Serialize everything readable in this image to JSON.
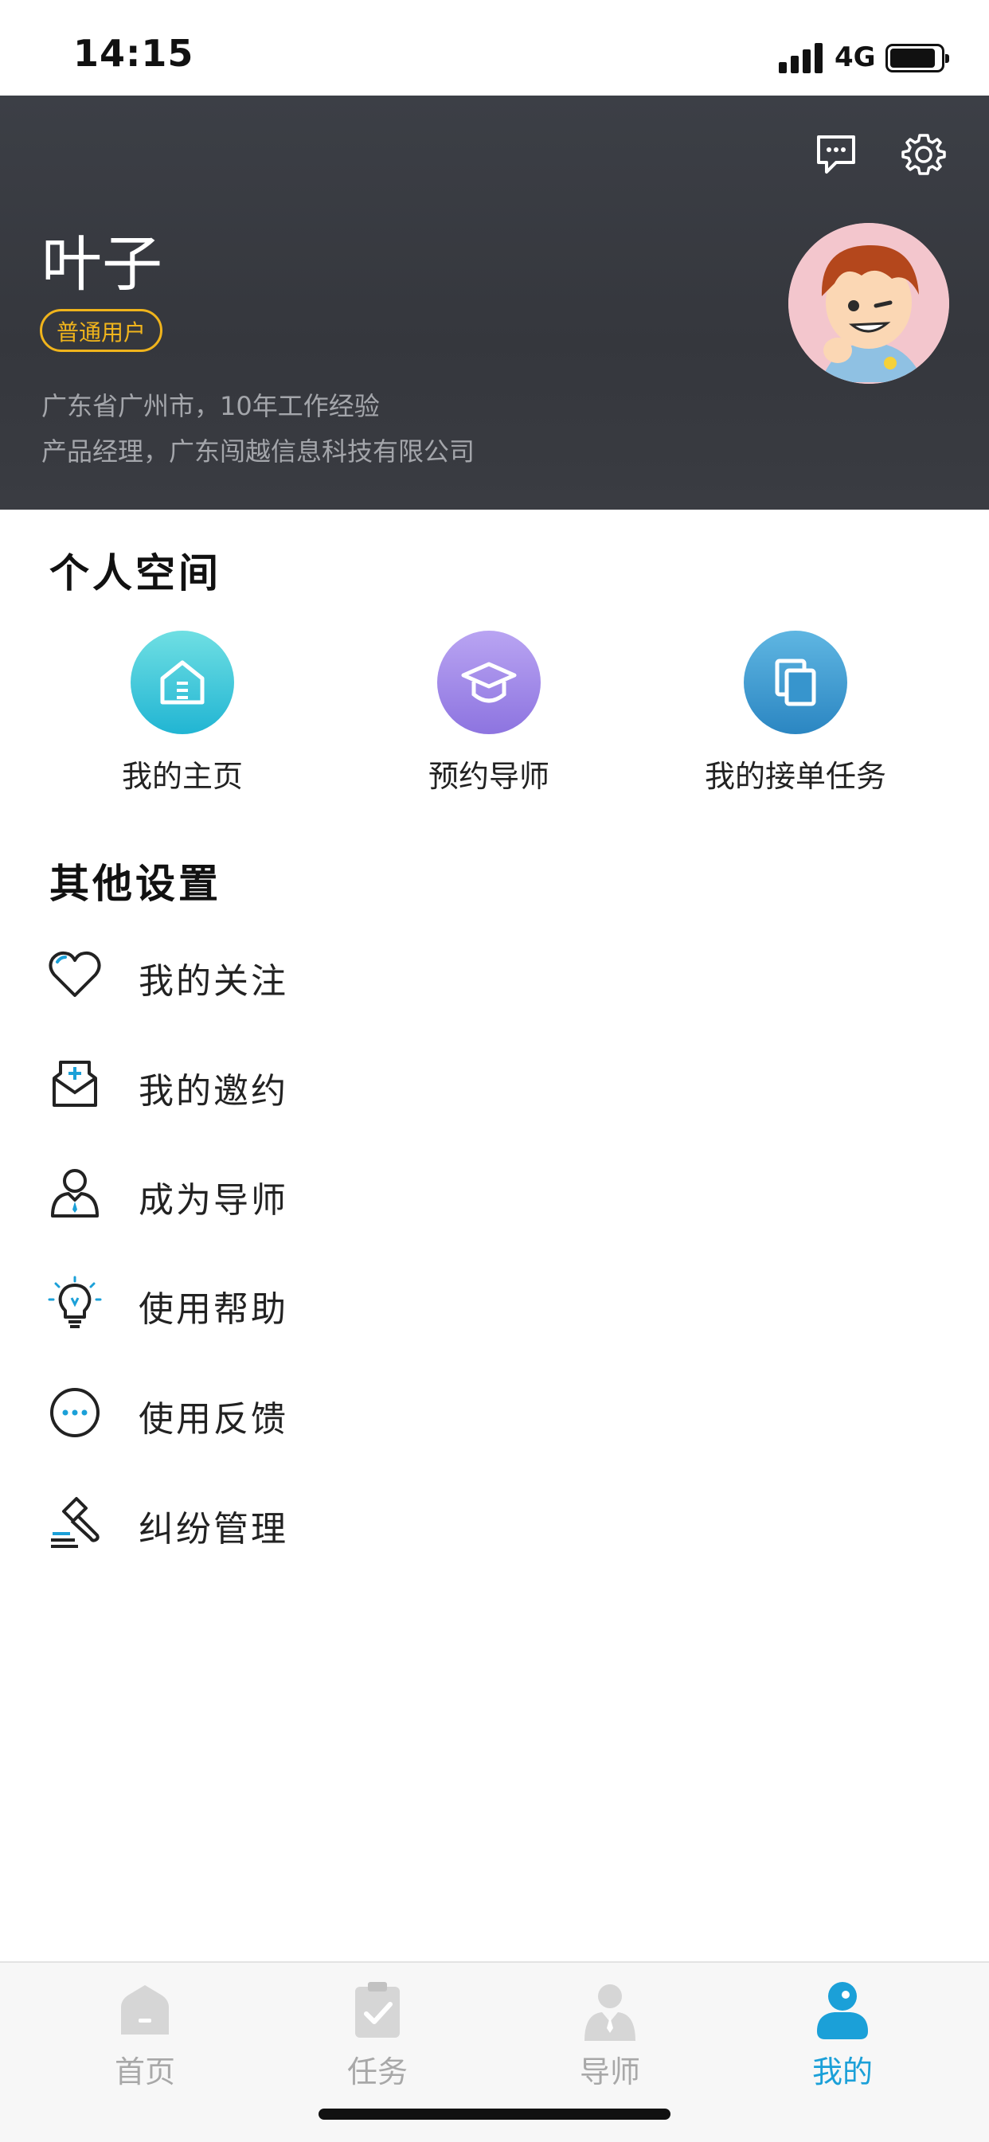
{
  "status_bar": {
    "time": "14:15",
    "network": "4G"
  },
  "header": {
    "name": "叶子",
    "badge": "普通用户",
    "location_line": "广东省广州市，10年工作经验",
    "job_line": "产品经理，广东闯越信息科技有限公司",
    "icons": {
      "message": "message-icon",
      "settings": "gear-icon"
    }
  },
  "personal_space": {
    "title": "个人空间",
    "items": [
      {
        "label": "我的主页",
        "icon": "home-icon",
        "color": "#3cc7d6"
      },
      {
        "label": "预约导师",
        "icon": "graduation-cap-icon",
        "color": "#9a85e6"
      },
      {
        "label": "我的接单任务",
        "icon": "documents-icon",
        "color": "#3b9ad0"
      }
    ]
  },
  "other_settings": {
    "title": "其他设置",
    "items": [
      {
        "label": "我的关注",
        "icon": "heart-icon"
      },
      {
        "label": "我的邀约",
        "icon": "invitation-icon"
      },
      {
        "label": "成为导师",
        "icon": "mentor-icon"
      },
      {
        "label": "使用帮助",
        "icon": "lightbulb-icon"
      },
      {
        "label": "使用反馈",
        "icon": "feedback-icon"
      },
      {
        "label": "纠纷管理",
        "icon": "gavel-icon"
      }
    ]
  },
  "tab_bar": {
    "active": "我的",
    "accent": "#1ba0d8",
    "inactive": "#a8a8a8",
    "tabs": [
      {
        "label": "首页",
        "icon": "home-tab-icon"
      },
      {
        "label": "任务",
        "icon": "clipboard-icon"
      },
      {
        "label": "导师",
        "icon": "teacher-icon"
      },
      {
        "label": "我的",
        "icon": "profile-tab-icon"
      }
    ]
  }
}
